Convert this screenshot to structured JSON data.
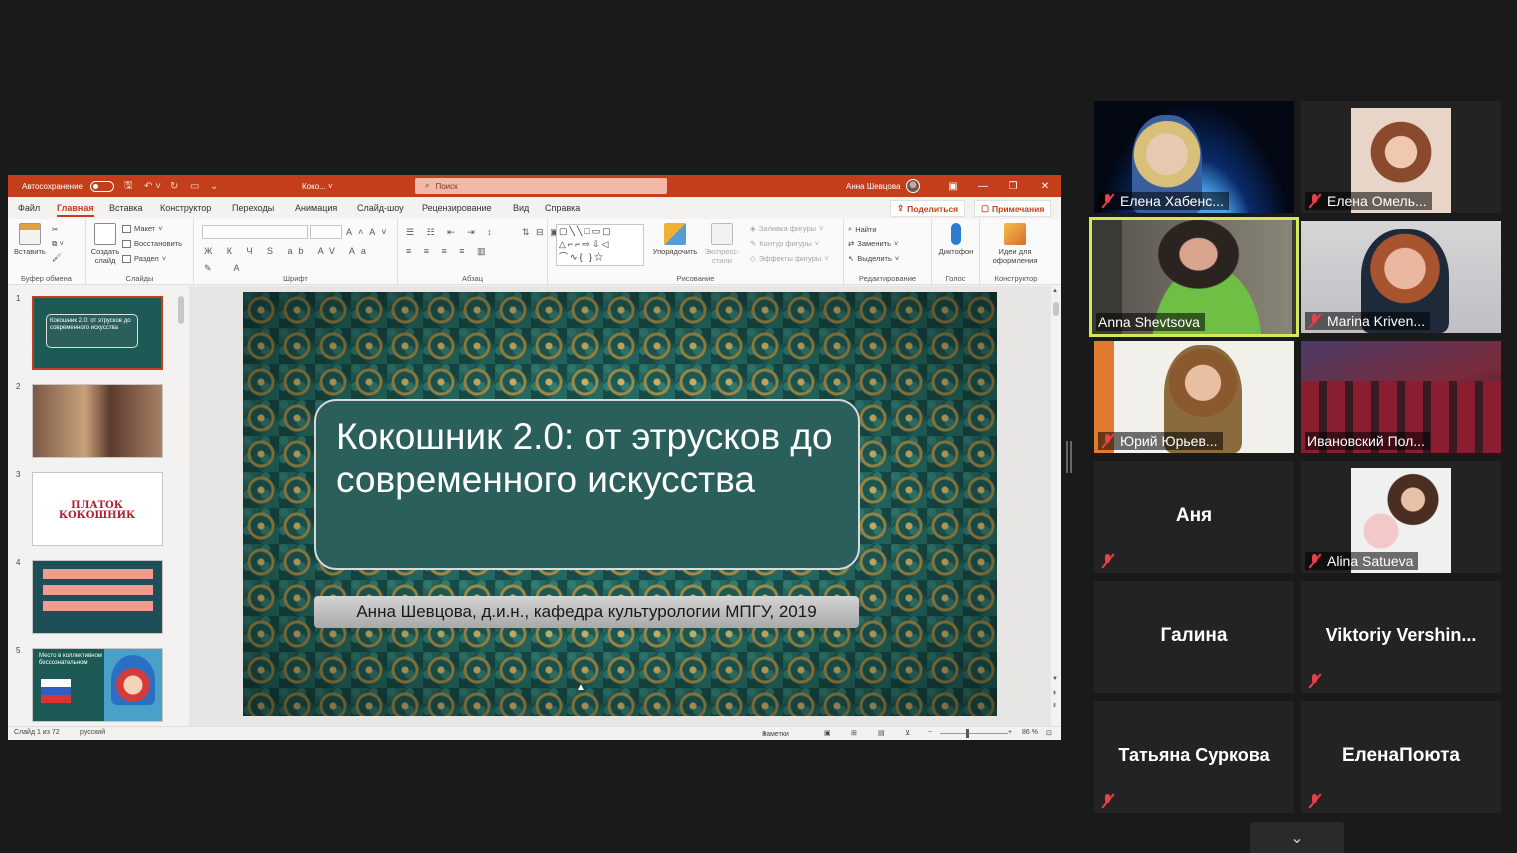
{
  "powerpoint": {
    "titlebar": {
      "autosave_label": "Автосохранение",
      "doc_title": "Коко... ˅",
      "search_placeholder": "Поиск",
      "user_name": "Анна Шевцова"
    },
    "tabs": [
      "Файл",
      "Главная",
      "Вставка",
      "Конструктор",
      "Переходы",
      "Анимация",
      "Слайд-шоу",
      "Рецензирование",
      "Вид",
      "Справка"
    ],
    "active_tab": "Главная",
    "share_label": "Поделиться",
    "comments_label": "Примечания",
    "ribbon": {
      "clipboard": {
        "paste": "Вставить",
        "group": "Буфер обмена"
      },
      "slides": {
        "new_slide": "Создать слайд",
        "layout": "Макет",
        "reset": "Восстановить",
        "section": "Раздел",
        "group": "Слайды"
      },
      "font": {
        "group": "Шрифт"
      },
      "paragraph": {
        "group": "Абзац"
      },
      "drawing": {
        "arrange": "Упорядочить",
        "quick_styles": "Экспресс-стили",
        "fill": "Заливка фигуры",
        "outline": "Контур фигуры",
        "effects": "Эффекты фигуры",
        "group": "Рисование"
      },
      "editing": {
        "find": "Найти",
        "replace": "Заменить",
        "select": "Выделить",
        "group": "Редактирование"
      },
      "voice": {
        "dictate": "Диктофон",
        "group": "Голос"
      },
      "designer": {
        "ideas": "Идеи для оформления",
        "group": "Конструктор"
      }
    },
    "thumbnails": [
      {
        "num": "1",
        "text": "Кокошник 2.0: от этрусков до современного искусства"
      },
      {
        "num": "2",
        "text": ""
      },
      {
        "num": "3",
        "text": "ПЛАТОК КОКОШНИК"
      },
      {
        "num": "4",
        "text": ""
      },
      {
        "num": "5",
        "text": "Место в коллективном бессознательном"
      }
    ],
    "slide": {
      "title": "Кокошник 2.0: от этрусков до современного искусства",
      "subtitle": "Анна Шевцова, д.и.н., кафедра культурологии МПГУ, 2019"
    },
    "status": {
      "slide_counter": "Слайд 1 из 72",
      "language": "русский",
      "notes": "Заметки",
      "zoom": "86 %"
    }
  },
  "zoom_gallery": {
    "participants": [
      {
        "name": "Елена Хабенс...",
        "muted": true,
        "video": true
      },
      {
        "name": "Елена Омель...",
        "muted": true,
        "video": true
      },
      {
        "name": "Anna Shevtsova",
        "muted": false,
        "video": true,
        "active_speaker": true
      },
      {
        "name": "Marina Kriven...",
        "muted": true,
        "video": true
      },
      {
        "name": "Юрий Юрьев...",
        "muted": true,
        "video": true
      },
      {
        "name": "Ивановский Пол...",
        "muted": false,
        "video": true
      },
      {
        "name": "Аня",
        "muted": true,
        "video": false
      },
      {
        "name": "Alina Satueva",
        "muted": true,
        "video": true
      },
      {
        "name": "Галина",
        "muted": false,
        "video": false
      },
      {
        "name": "Viktoriy  Vershin...",
        "muted": true,
        "video": false
      },
      {
        "name": "Татьяна Суркова",
        "muted": true,
        "video": false
      },
      {
        "name": "ЕленаПоюта",
        "muted": true,
        "video": false
      }
    ]
  },
  "colors": {
    "ppt_accent": "#c43e1c",
    "active_speaker_border": "#d5e85a",
    "muted_icon": "#e8404a",
    "slide_box": "#2b5f5c"
  }
}
